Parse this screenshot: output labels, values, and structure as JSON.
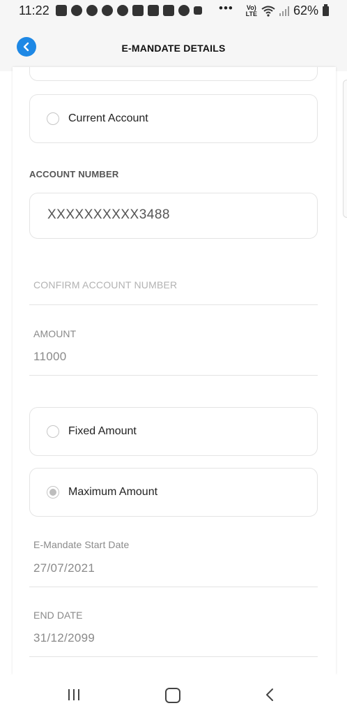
{
  "status_bar": {
    "time": "11:22",
    "dots": "•••",
    "volte": "Vo)\nLTE",
    "battery": "62%"
  },
  "header": {
    "title": "E-MANDATE DETAILS"
  },
  "account_type": {
    "current_label": "Current Account"
  },
  "account_number": {
    "label": "ACCOUNT NUMBER",
    "value": "XXXXXXXXXX3488"
  },
  "confirm_account": {
    "placeholder": "CONFIRM ACCOUNT NUMBER"
  },
  "amount": {
    "label": "AMOUNT",
    "value": "11000"
  },
  "amount_type": {
    "fixed_label": "Fixed Amount",
    "maximum_label": "Maximum Amount",
    "selected": "Maximum Amount"
  },
  "start_date": {
    "label": "E-Mandate Start Date",
    "value": "27/07/2021"
  },
  "end_date": {
    "label": "END DATE",
    "value": "31/12/2099"
  },
  "colors": {
    "accent": "#1e88e5",
    "header_bg": "#f6f6f6"
  }
}
